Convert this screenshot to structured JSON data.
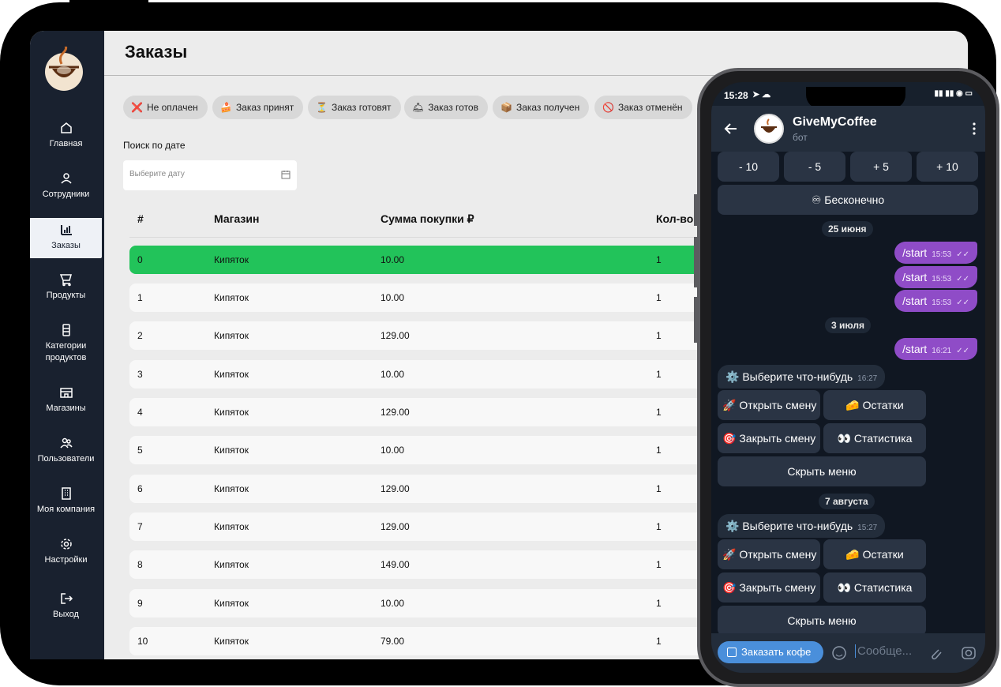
{
  "app": {
    "page_title": "Заказы",
    "nav": [
      {
        "label": "Главная",
        "icon": "home-icon"
      },
      {
        "label": "Сотрудники",
        "icon": "users-icon"
      },
      {
        "label": "Заказы",
        "icon": "bar-chart-icon",
        "active": true
      },
      {
        "label": "Продукты",
        "icon": "cart-icon"
      },
      {
        "label": "Категории продуктов",
        "icon": "category-icon"
      },
      {
        "label": "Магазины",
        "icon": "store-icon"
      },
      {
        "label": "Пользователи",
        "icon": "user-group-icon"
      },
      {
        "label": "Моя компания",
        "icon": "building-icon"
      },
      {
        "label": "Настройки",
        "icon": "gear-icon"
      },
      {
        "label": "Выход",
        "icon": "logout-icon"
      }
    ],
    "filters": [
      {
        "icon": "❌",
        "label": "Не оплачен"
      },
      {
        "icon": "🍰",
        "label": "Заказ принят"
      },
      {
        "icon": "⏳",
        "label": "Заказ готовят"
      },
      {
        "icon": "🛎",
        "label": "Заказ готов"
      },
      {
        "icon": "📦",
        "label": "Заказ получен"
      },
      {
        "icon": "🚫",
        "label": "Заказ отменён"
      }
    ],
    "search": {
      "label": "Поиск по дате",
      "placeholder": "Выберите дату"
    },
    "table": {
      "headers": [
        "#",
        "Магазин",
        "Сумма покупки ₽",
        "Кол-во"
      ],
      "rows": [
        {
          "id": "0",
          "store": "Кипяток",
          "sum": "10.00",
          "qty": "1"
        },
        {
          "id": "1",
          "store": "Кипяток",
          "sum": "10.00",
          "qty": "1"
        },
        {
          "id": "2",
          "store": "Кипяток",
          "sum": "129.00",
          "qty": "1"
        },
        {
          "id": "3",
          "store": "Кипяток",
          "sum": "10.00",
          "qty": "1"
        },
        {
          "id": "4",
          "store": "Кипяток",
          "sum": "129.00",
          "qty": "1"
        },
        {
          "id": "5",
          "store": "Кипяток",
          "sum": "10.00",
          "qty": "1"
        },
        {
          "id": "6",
          "store": "Кипяток",
          "sum": "129.00",
          "qty": "1"
        },
        {
          "id": "7",
          "store": "Кипяток",
          "sum": "129.00",
          "qty": "1"
        },
        {
          "id": "8",
          "store": "Кипяток",
          "sum": "149.00",
          "qty": "1"
        },
        {
          "id": "9",
          "store": "Кипяток",
          "sum": "10.00",
          "qty": "1"
        },
        {
          "id": "10",
          "store": "Кипяток",
          "sum": "79.00",
          "qty": "1"
        }
      ]
    },
    "colors": {
      "sidebar": "#19212f",
      "highlight_row": "#22c35a"
    }
  },
  "phone": {
    "time": "15:28",
    "bot_name": "GiveMyCoffee",
    "bot_sub": "бот",
    "step_buttons": [
      "- 10",
      "- 5",
      "+ 5",
      "+ 10"
    ],
    "infinite_button": "♾ Бесконечно",
    "date1": "25 июня",
    "out_msgs": [
      {
        "text": "/start",
        "time": "15:53"
      },
      {
        "text": "/start",
        "time": "15:53"
      },
      {
        "text": "/start",
        "time": "15:53"
      }
    ],
    "date2": "3 июля",
    "out_msg4": {
      "text": "/start",
      "time": "16:21"
    },
    "in_msg1": {
      "text": "⚙️ Выберите что-нибудь",
      "time": "16:27"
    },
    "menu1": {
      "open_shift": "🚀 Открыть смену",
      "remains": "🧀 Остатки",
      "close_shift": "🎯 Закрыть смену",
      "stats": "👀 Статистика",
      "hide": "Скрыть меню"
    },
    "date3": "7 августа",
    "in_msg2": {
      "text": "⚙️ Выберите что-нибудь",
      "time": "15:27"
    },
    "order_button": "Заказать кофе",
    "message_placeholder": "Сообще..."
  }
}
